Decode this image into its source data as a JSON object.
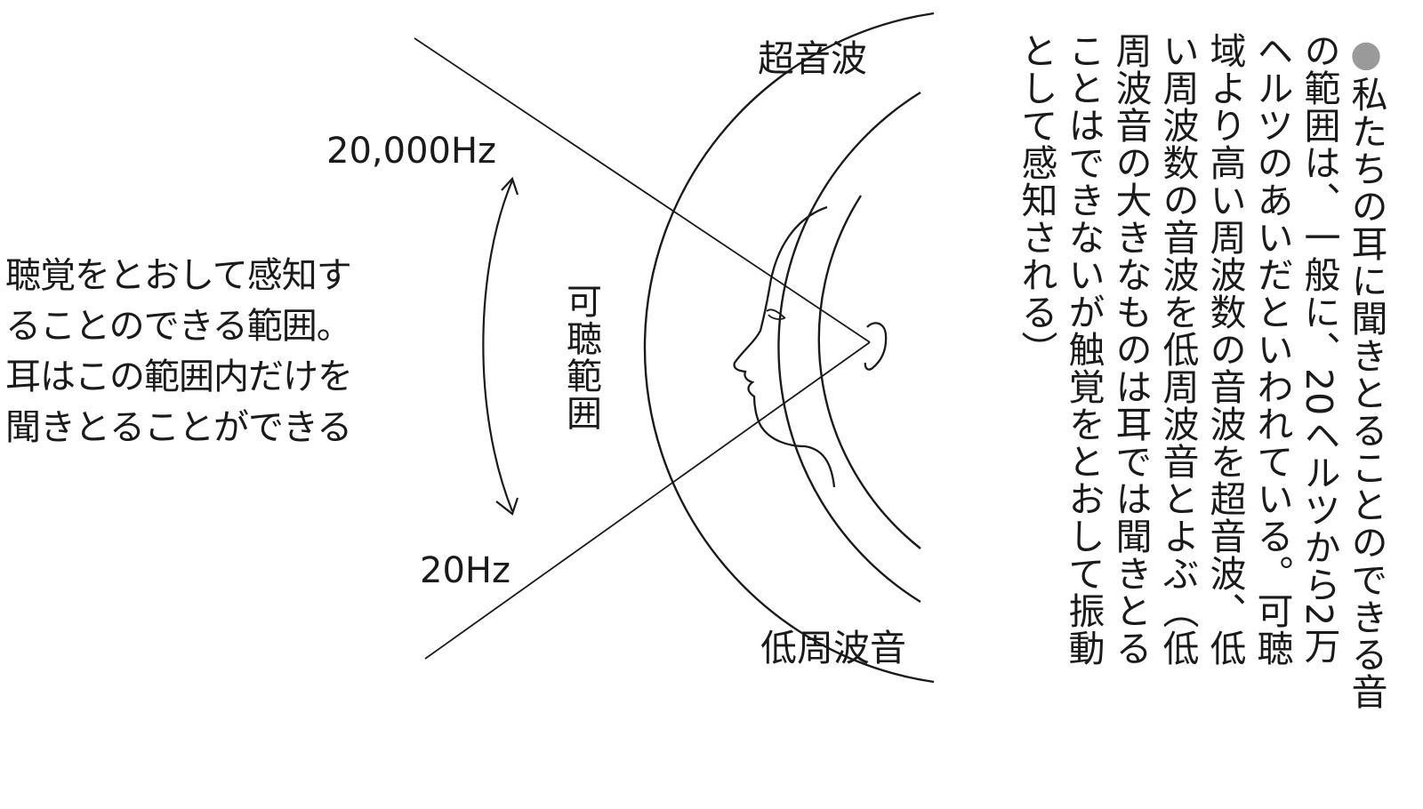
{
  "diagram": {
    "outer_band_label": "超音波",
    "inner_band_label": "可聴範囲",
    "low_band_label": "低周波音",
    "upper_limit": "20,000Hz",
    "lower_limit": "20Hz"
  },
  "left_caption": {
    "lines": [
      "聴覚をとおして感知す",
      "ることのできる範囲。",
      "耳はこの範囲内だけを",
      "聞きとることができる"
    ]
  },
  "right_note": {
    "bullet": "●",
    "lines": [
      "私たちの耳に聞きとることのできる音",
      "の範囲は、一般に、20ヘルツから2万",
      "ヘルツのあいだといわれている。可聴",
      "域より高い周波数の音波を超音波、低",
      "い周波数の音波を低周波音とよぶ（低",
      "周波音の大きなものは耳では聞きとる",
      "ことはできないが触覚をとおして振動",
      "として感知される）"
    ]
  }
}
